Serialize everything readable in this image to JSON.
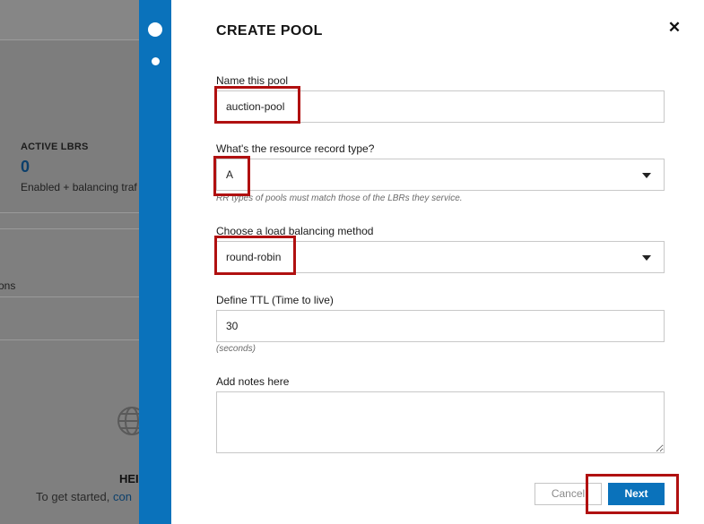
{
  "background": {
    "card": {
      "label": "ACTIVE LBRS",
      "value": "0",
      "subtitle": "Enabled + balancing traf"
    },
    "row_text": "ons",
    "help": {
      "title": "HEI",
      "text_prefix": "To get started, ",
      "link": "con"
    }
  },
  "modal": {
    "title": "CREATE POOL",
    "close_icon": "close-icon",
    "name": {
      "label": "Name this pool",
      "value": "auction-pool"
    },
    "rr_type": {
      "label": "What's the resource record type?",
      "value": "A",
      "hint": "RR types of pools must match those of the LBRs they service."
    },
    "method": {
      "label": "Choose a load balancing method",
      "value": "round-robin"
    },
    "ttl": {
      "label": "Define TTL (Time to live)",
      "value": "30",
      "hint": "(seconds)"
    },
    "notes": {
      "label": "Add notes here",
      "value": ""
    },
    "buttons": {
      "cancel": "Cancel",
      "next": "Next"
    }
  },
  "colors": {
    "accent": "#0a72bb",
    "highlight": "#b01010",
    "overlay": "#7f7f7f"
  }
}
